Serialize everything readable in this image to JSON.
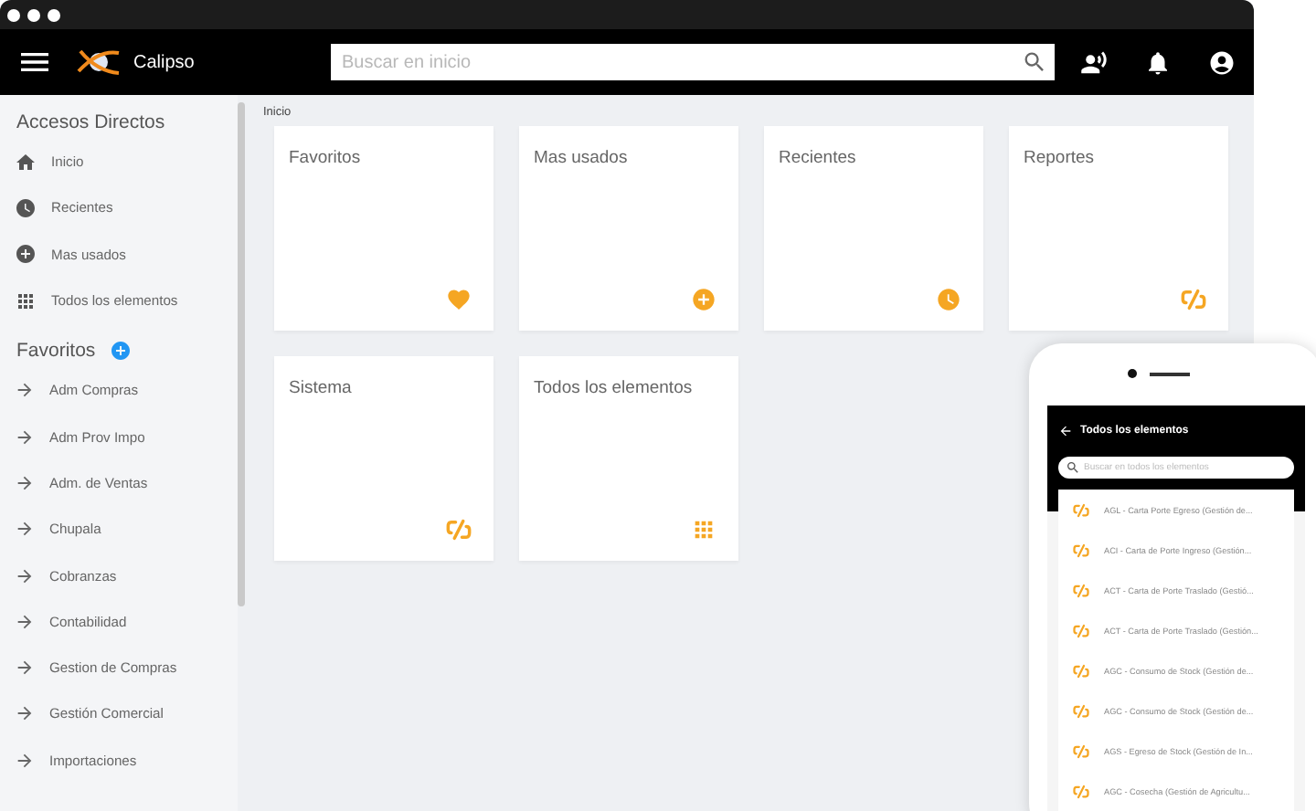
{
  "app": {
    "name": "Calipso"
  },
  "search": {
    "placeholder": "Buscar en inicio"
  },
  "sidebar": {
    "shortcuts_title": "Accesos Directos",
    "shortcuts": [
      {
        "label": "Inicio",
        "kind": "home"
      },
      {
        "label": "Recientes",
        "kind": "clock"
      },
      {
        "label": "Mas usados",
        "kind": "plus"
      },
      {
        "label": "Todos los elementos",
        "kind": "grid"
      }
    ],
    "favorites_title": "Favoritos",
    "favorites": [
      "Adm Compras",
      "Adm Prov Impo",
      "Adm. de Ventas",
      "Chupala",
      "Cobranzas",
      "Contabilidad",
      "Gestion de Compras",
      "Gestión Comercial",
      "Importaciones"
    ]
  },
  "breadcrumb": "Inicio",
  "cards": [
    {
      "title": "Favoritos",
      "kind": "heart"
    },
    {
      "title": "Mas usados",
      "kind": "plus"
    },
    {
      "title": "Recientes",
      "kind": "clock"
    },
    {
      "title": "Reportes",
      "kind": "link"
    },
    {
      "title": "Sistema",
      "kind": "link"
    },
    {
      "title": "Todos los elementos",
      "kind": "grid"
    }
  ],
  "phone": {
    "title": "Todos los elementos",
    "placeholder": "Buscar en todos los elementos",
    "items": [
      "AGL - Carta Porte Egreso (Gestión de...",
      "ACI - Carta de Porte Ingreso (Gestión...",
      "ACT - Carta de Porte Traslado (Gestió...",
      "ACT - Carta de Porte Traslado (Gestión...",
      "AGC - Consumo de Stock (Gestión de...",
      "AGC - Consumo de Stock (Gestión de...",
      "AGS - Egreso de Stock (Gestión de In...",
      "AGC - Cosecha (Gestión de Agricultu..."
    ]
  }
}
